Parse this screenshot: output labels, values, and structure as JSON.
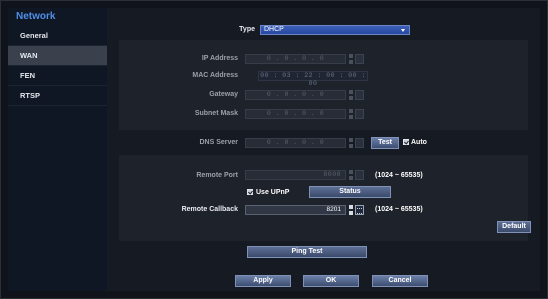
{
  "sidebar": {
    "title": "Network",
    "items": [
      {
        "label": "General",
        "active": false
      },
      {
        "label": "WAN",
        "active": true
      },
      {
        "label": "FEN",
        "active": false
      },
      {
        "label": "RTSP",
        "active": false
      }
    ]
  },
  "form": {
    "type_label": "Type",
    "type_value": "DHCP",
    "ip_label": "IP Address",
    "ip_value": "0 . 0 . 0 . 0",
    "mac_label": "MAC Address",
    "mac_value": "00 : 03 : 22 : 00 : 00 : 00",
    "gateway_label": "Gateway",
    "gateway_value": "0 . 0 . 0 . 0",
    "subnet_label": "Subnet Mask",
    "subnet_value": "0 . 0 . 0 . 0",
    "dns_label": "DNS Server",
    "dns_value": "0 . 0 . 0 . 0",
    "test_button": "Test",
    "auto_label": "Auto",
    "remote_port_label": "Remote Port",
    "remote_port_value": "8000",
    "remote_port_range": "(1024 ~ 65535)",
    "upnp_label": "Use UPnP",
    "status_button": "Status",
    "remote_callback_label": "Remote Callback",
    "remote_callback_value": "8201",
    "remote_callback_range": "(1024 ~ 65535)",
    "default_button": "Default",
    "ping_button": "Ping Test"
  },
  "footer": {
    "apply": "Apply",
    "ok": "OK",
    "cancel": "Cancel"
  }
}
